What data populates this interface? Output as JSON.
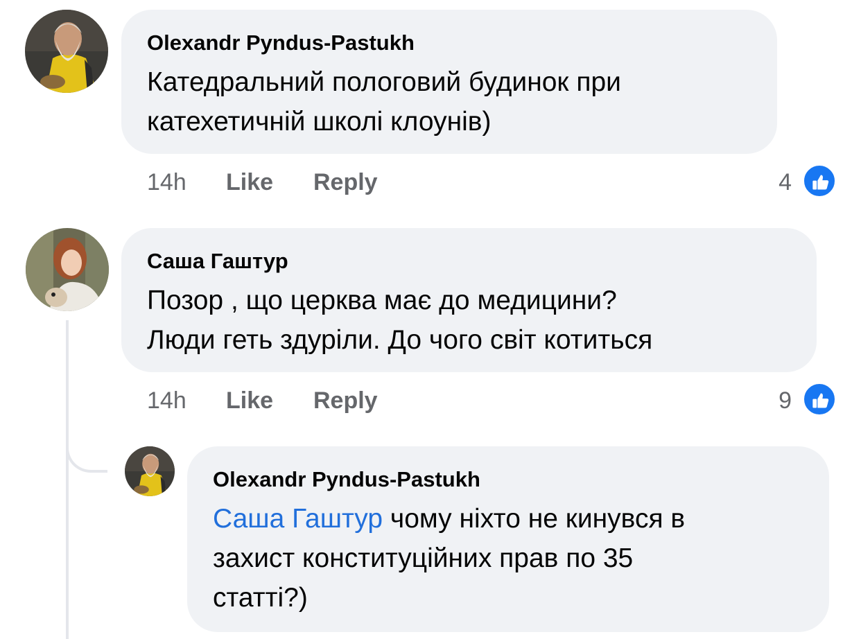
{
  "comments": [
    {
      "author": "Olexandr Pyndus-Pastukh",
      "text_line1": "Катедральний пологовий будинок при",
      "text_line2": "катехетичній школі клоунів)",
      "time": "14h",
      "like_label": "Like",
      "reply_label": "Reply",
      "reaction_count": "4",
      "reaction_icon": "like-thumb-icon"
    },
    {
      "author": "Саша Гаштур",
      "text_line1": "Позор , що церква має до медицини?",
      "text_line2": "Люди геть здуріли. До чого світ котиться",
      "time": "14h",
      "like_label": "Like",
      "reply_label": "Reply",
      "reaction_count": "9",
      "reaction_icon": "like-thumb-icon"
    }
  ],
  "reply": {
    "author": "Olexandr Pyndus-Pastukh",
    "mention": "Саша Гаштур",
    "text_line1_rest": " чому ніхто не кинувся в",
    "text_line2": "захист конституційних прав по 35",
    "text_line3": "статті?)"
  },
  "colors": {
    "bubble": "#f0f2f5",
    "mention": "#216fdb",
    "meta": "#65676b",
    "like_blue": "#1877f2"
  }
}
